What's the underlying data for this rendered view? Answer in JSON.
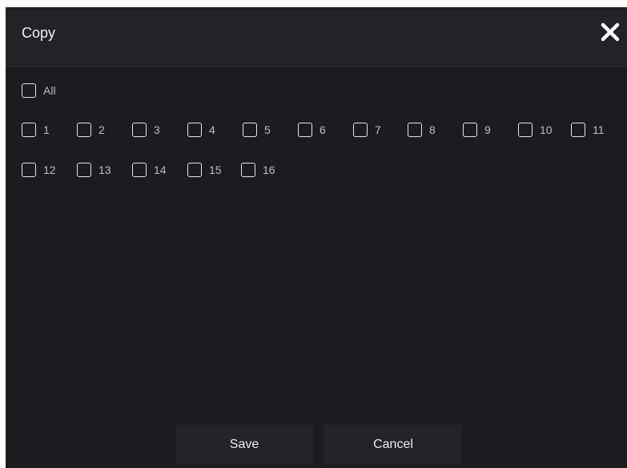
{
  "dialog": {
    "title": "Copy",
    "close_icon": "close-icon"
  },
  "all_option": {
    "label": "All",
    "checked": false
  },
  "channels": [
    {
      "label": "1",
      "checked": false
    },
    {
      "label": "2",
      "checked": false
    },
    {
      "label": "3",
      "checked": false
    },
    {
      "label": "4",
      "checked": false
    },
    {
      "label": "5",
      "checked": false
    },
    {
      "label": "6",
      "checked": false
    },
    {
      "label": "7",
      "checked": false
    },
    {
      "label": "8",
      "checked": false
    },
    {
      "label": "9",
      "checked": false
    },
    {
      "label": "10",
      "checked": false
    },
    {
      "label": "11",
      "checked": false
    },
    {
      "label": "12",
      "checked": false
    },
    {
      "label": "13",
      "checked": false
    },
    {
      "label": "14",
      "checked": false
    },
    {
      "label": "15",
      "checked": false
    },
    {
      "label": "16",
      "checked": false
    }
  ],
  "buttons": {
    "save_label": "Save",
    "cancel_label": "Cancel"
  },
  "colors": {
    "background": "#1b1c20",
    "titlebar": "#222327",
    "checkbox_border": "#e6e6e6",
    "text": "#bdbdbd"
  }
}
